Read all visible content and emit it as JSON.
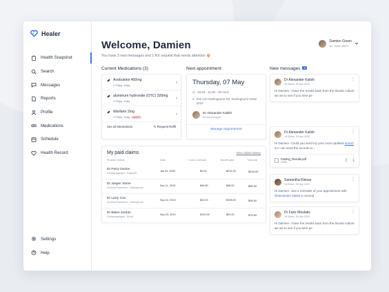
{
  "app": {
    "name": "Healer"
  },
  "sidebar": {
    "items": [
      {
        "label": "Health Snapshot",
        "icon": "clipboard-icon",
        "active": true
      },
      {
        "label": "Search",
        "icon": "search-icon"
      },
      {
        "label": "Messages",
        "icon": "message-icon"
      },
      {
        "label": "Reports",
        "icon": "document-icon"
      },
      {
        "label": "Profile",
        "icon": "person-icon"
      },
      {
        "label": "Medications",
        "icon": "pill-icon"
      },
      {
        "label": "Schedule",
        "icon": "calendar-icon"
      },
      {
        "label": "Health Record",
        "icon": "heart-icon"
      }
    ],
    "bottom": [
      {
        "label": "Settings",
        "icon": "gear-icon"
      },
      {
        "label": "Help",
        "icon": "help-icon"
      }
    ]
  },
  "header": {
    "welcome": "Welcome, Damien",
    "subtitle": "You have 3 new messages and 1 RX request that needs attention 🍿"
  },
  "user": {
    "name": "Damien Green",
    "id": "No: 4455 45871"
  },
  "medications": {
    "title": "Current Medications (3)",
    "items": [
      {
        "name": "Acebutolol 400mg",
        "dose": "2 Pill(s), Daily",
        "alert": ""
      },
      {
        "name": "aluminum hydroxide (OTC) 320mg",
        "dose": "2 Pill(s), Daily",
        "alert": ""
      },
      {
        "name": "Warfarin 2mg",
        "dose": "2 Pill(s), Daily",
        "alert": "ALERT"
      }
    ],
    "see_all": "See all interactions",
    "refill": "Request Refill"
  },
  "appointment": {
    "title": "Next appointment",
    "date": "Thursday, 07 May",
    "time": "10:33 - 11:00 · 30 mins",
    "address": "219 210 Darlinghurst Rd, Darlinghurst NSW 2010",
    "doctor": "Dr Alexander Kalish",
    "specialty": "Endocrinologist",
    "manage": "Manage Appointment"
  },
  "claims": {
    "title": "My paid claims",
    "link": "View claims history",
    "headers": [
      "Provider Details",
      "Date",
      "Cost to claimant",
      "Benefit paid",
      "Total cost"
    ],
    "rows": [
      {
        "name": "Dr Perry Dorien",
        "sub": "Otolaryngologist - Edgecliff",
        "date": "Jan 03, 2020",
        "cost": "$0.00",
        "benefit": "$234.00",
        "total": "$234.00"
      },
      {
        "name": "Dr Jasper Stone",
        "sub": "General Practioner - Darlinghurst",
        "date": "Dec 11, 2019",
        "cost": "$46.80",
        "benefit": "$48.00",
        "total": "$85.00"
      },
      {
        "name": "Dr Larry Cox",
        "sub": "General Practioner - Darlinghurst",
        "date": "Sep 24, 2019",
        "cost": "$23.00",
        "benefit": "$198.00",
        "total": "$56.00"
      },
      {
        "name": "Dr Blaire Jordan",
        "sub": "Otolaryngologist - Bondi",
        "date": "Sep 23, 2019",
        "cost": "$120.00",
        "benefit": "$20.00",
        "total": "$75.00"
      }
    ]
  },
  "messages": {
    "title": "New messages",
    "count": "4",
    "items": [
      {
        "from": "Dr Alexander Kalish",
        "time": "10:35am, 30 Apr 2020",
        "pre": "Hi Damien. I have the results back from the bloodo culture we we to see if you here pe",
        "mention": "",
        "link": "",
        "post": ""
      },
      {
        "from": "Dr Alexander Kalish",
        "time": "10:35am, 30 Apr 2020",
        "pre": "Hi Damien. Could you send my your most updated ",
        "mention": "",
        "link": "email?",
        "post": " so I can send the records to ...",
        "attach_name": "Fasting_Results.pdf",
        "attach_size": "240kb"
      },
      {
        "from": "Samantha Kleizar",
        "time": "10:35am, 30 Apr 2020",
        "pre": "Hi Damien. Just a reminder of your appointment with ",
        "mention": "@alexander kalish",
        "link": "",
        "post": " in around"
      },
      {
        "from": "Dr Fariz Moulaks",
        "time": "10:35am, 30 Apr 2020",
        "pre": "Hi Damien. I have the results back from the bloodo culture we we to see if you here pe",
        "mention": "",
        "link": "",
        "post": ""
      }
    ]
  },
  "colors": {
    "accent": "#3c70e8",
    "alert": "#d43c3c"
  }
}
